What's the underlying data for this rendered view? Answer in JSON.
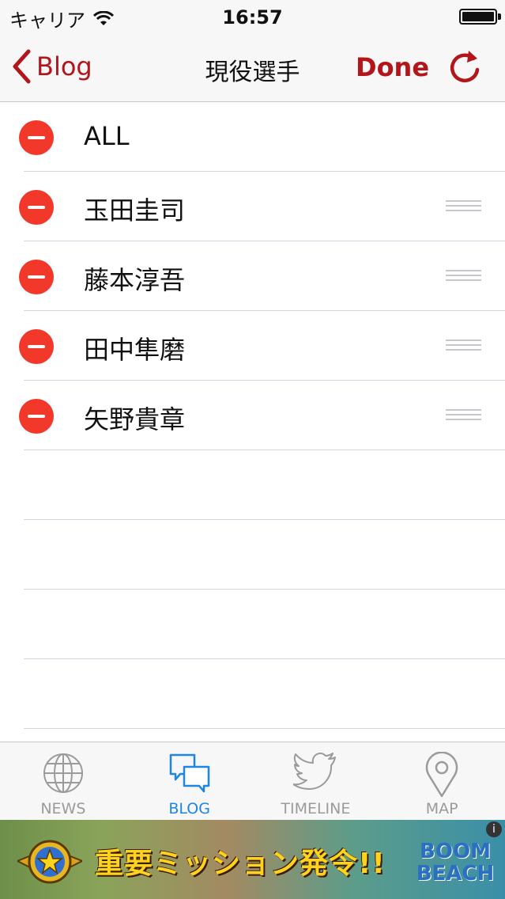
{
  "status_bar": {
    "carrier": "キャリア",
    "time": "16:57"
  },
  "nav": {
    "back_label": "Blog",
    "title": "現役選手",
    "done_label": "Done",
    "accent_color": "#b3151b"
  },
  "list": {
    "items": [
      {
        "label": "ALL",
        "reorderable": false
      },
      {
        "label": "玉田圭司",
        "reorderable": true
      },
      {
        "label": "藤本淳吾",
        "reorderable": true
      },
      {
        "label": "田中隼磨",
        "reorderable": true
      },
      {
        "label": "矢野貴章",
        "reorderable": true
      }
    ]
  },
  "tabs": [
    {
      "label": "NEWS",
      "icon": "globe-icon",
      "active": false
    },
    {
      "label": "BLOG",
      "icon": "chat-bubbles-icon",
      "active": true
    },
    {
      "label": "TIMELINE",
      "icon": "bird-icon",
      "active": false
    },
    {
      "label": "MAP",
      "icon": "map-pin-icon",
      "active": false
    }
  ],
  "ad": {
    "headline": "重要ミッション発令!!",
    "logo_text": "BOOM BEACH",
    "info_glyph": "i"
  }
}
